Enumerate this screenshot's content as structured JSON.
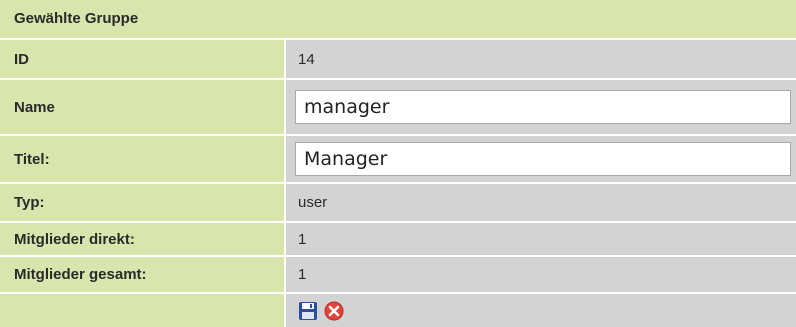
{
  "panel": {
    "title": "Gewählte Gruppe",
    "rows": [
      {
        "label": "ID",
        "value": "14"
      },
      {
        "label": "Name",
        "input_value": "manager"
      },
      {
        "label": "Titel:",
        "input_value": "Manager"
      },
      {
        "label": "Typ:",
        "value": "user"
      },
      {
        "label": "Mitglieder direkt:",
        "value": "1"
      },
      {
        "label": "Mitglieder gesamt:",
        "value": "1"
      }
    ],
    "actions": {
      "save_icon": "floppy-disk-icon",
      "cancel_icon": "red-x-circle-icon"
    }
  },
  "colors": {
    "label_bg": "#d8e5ad",
    "value_bg": "#d3d3d3",
    "save_icon": "#2b4f9c",
    "cancel_icon": "#e0443a"
  }
}
